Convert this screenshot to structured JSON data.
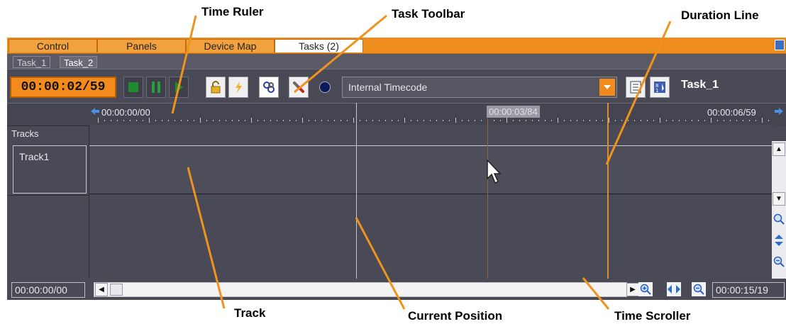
{
  "callouts": {
    "time_ruler": "Time Ruler",
    "task_toolbar": "Task Toolbar",
    "duration_line": "Duration Line",
    "track": "Track",
    "current_position": "Current Position",
    "time_scroller": "Time Scroller"
  },
  "tabs": [
    "Control",
    "Panels",
    "Device Map",
    "Tasks (2)"
  ],
  "active_tab": "Tasks (2)",
  "subtabs": [
    "Task_1",
    "Task_2"
  ],
  "active_subtab": "Task_1",
  "toolbar": {
    "time": "00:00:02/59",
    "timecode_source": "Internal Timecode",
    "task_name": "Task_1",
    "icons": [
      "stop-icon",
      "pause-icon",
      "play-icon",
      "lock-icon",
      "flash-icon",
      "chain-icon",
      "wrench-icon",
      "record-dot-icon",
      "dropdown-arrow-icon",
      "list-view-icon",
      "sort-icon"
    ]
  },
  "ruler": {
    "start": "00:00:00/00",
    "hover": "00:00:03/84",
    "end": "00:00:06/59"
  },
  "tracks": {
    "header": "Tracks",
    "items": [
      "Track1"
    ]
  },
  "scroller": {
    "start": "00:00:00/00",
    "end": "00:00:15/19"
  },
  "colors": {
    "accent": "#f28a1c",
    "background": "#4a4a57",
    "callout_line": "#f0921e",
    "current_position_line": "#c8c8d0",
    "duration_line": "#e08a2a"
  }
}
